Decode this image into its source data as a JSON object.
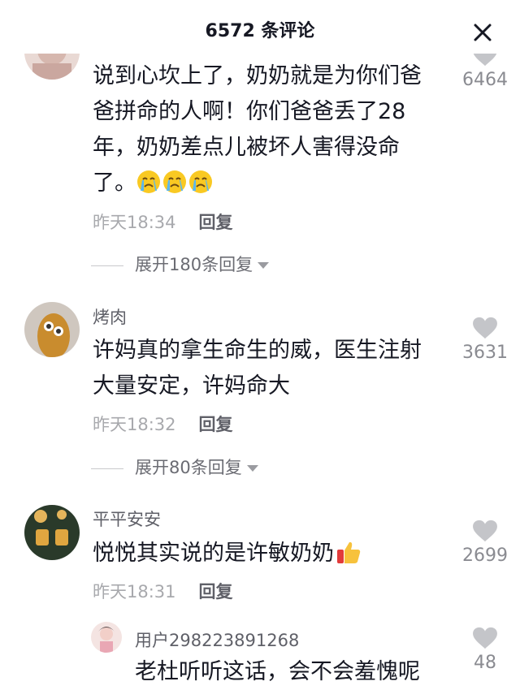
{
  "header": {
    "title": "6572 条评论"
  },
  "comments": [
    {
      "text_lines": [
        "说到心坎上了，奶奶就是为你们爸",
        "爸拼命的人啊！你们爸爸丢了28",
        "年，奶奶差点儿被坏人害得没命",
        "了。"
      ],
      "emoji": "crying-face-emoji",
      "time": "昨天18:34",
      "reply_label": "回复",
      "likes": "6464",
      "expand": "展开180条回复"
    },
    {
      "author": "烤肉",
      "text_lines": [
        "许妈真的拿生命生的威，医生注射",
        "大量安定，许妈命大"
      ],
      "time": "昨天18:32",
      "reply_label": "回复",
      "likes": "3631",
      "expand": "展开80条回复"
    },
    {
      "author": "平平安安",
      "text_lines": [
        "悦悦其实说的是许敏奶奶"
      ],
      "emoji": "thumbs-up-emoji",
      "time": "昨天18:31",
      "reply_label": "回复",
      "likes": "2699"
    },
    {
      "author": "用户298223891268",
      "text_lines": [
        "老杜听听这话，会不会羞愧呢"
      ],
      "likes": "48"
    }
  ],
  "colors": {
    "heart": "#c4c5c9",
    "meta": "#a8a9ad",
    "text": "#161823"
  }
}
